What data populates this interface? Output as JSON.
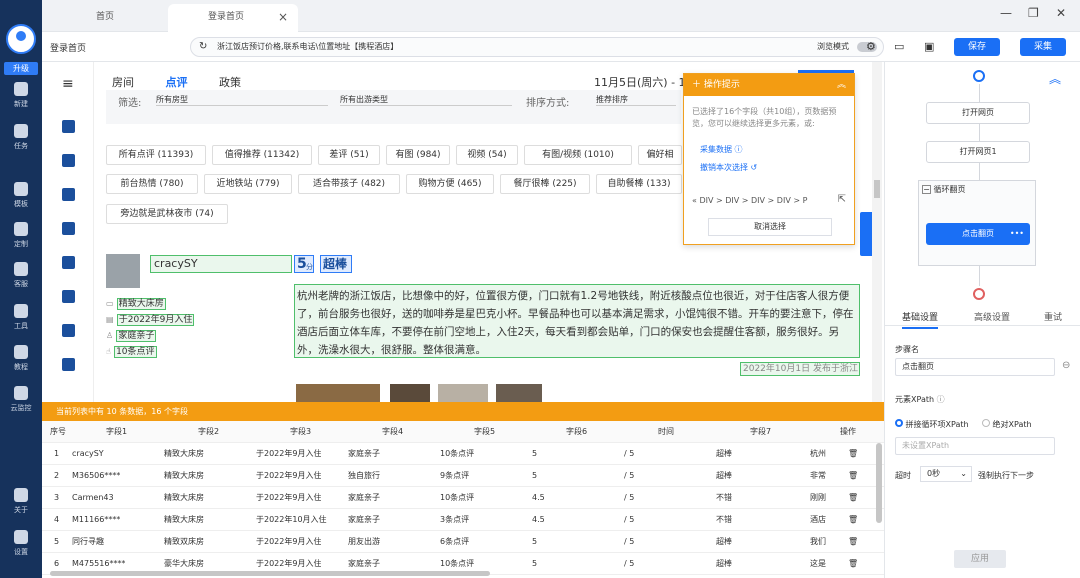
{
  "app": {
    "upgrade": "升级"
  },
  "nav": [
    {
      "label": "新建"
    },
    {
      "label": "任务"
    },
    {
      "label": "模板"
    },
    {
      "label": "定制"
    },
    {
      "label": "客服"
    },
    {
      "label": "工具"
    },
    {
      "label": "教程"
    },
    {
      "label": "云监控"
    },
    {
      "label": "关于"
    },
    {
      "label": "设置"
    }
  ],
  "tabs": {
    "home": "首页",
    "active": "登录首页"
  },
  "toolbar": {
    "left_label": "登录首页",
    "url": "浙江饭店预订价格,联系电话\\位置地址【携程酒店】",
    "browse_mode": "浏览模式",
    "save": "保存",
    "collect": "采集"
  },
  "page": {
    "tabs": [
      "房间",
      "点评",
      "政策"
    ],
    "date": "11月5日(周六) - 11",
    "filter_label": "筛选:",
    "room_select": "所有房型",
    "trip_select": "所有出游类型",
    "sort_label": "排序方式:",
    "sort_select": "推荐排序",
    "chips_row1": [
      "所有点评 (11393)",
      "值得推荐 (11342)",
      "差评 (51)",
      "有图 (984)",
      "视频 (54)",
      "有图/视频 (1010)",
      "偏好相"
    ],
    "chips_row2": [
      "前台热情 (780)",
      "近地铁站 (779)",
      "适合带孩子 (482)",
      "购物方便 (465)",
      "餐厅很棒 (225)",
      "自助餐棒 (133)"
    ],
    "chips_row3": [
      "旁边就是武林夜市 (74)"
    ],
    "review": {
      "user": "cracySY",
      "score": "5",
      "score_unit": "分",
      "rating_word": "超棒",
      "room": "精致大床房",
      "stay": "于2022年9月入住",
      "trip": "家庭亲子",
      "count": "10条点评",
      "text": "杭州老牌的浙江饭店，比想像中的好，位置很方便，门口就有1.2号地铁线，附近核酸点位也很近，对于住店客人很方便了，前台服务也很好，送的咖啡券是星巴克小杯。早餐品种也可以基本满足需求，小馄饨很不错。开车的要注意下，停在酒店后面立体车库，不要停在前门空地上，入住2天，每天看到都会贴单，门口的保安也会提醒住客额，服务很好。另外，洗澡水很大，很舒服。整体很满意。",
      "date": "2022年10月1日 发布于浙江"
    }
  },
  "tip": {
    "title": "操作提示",
    "desc": "已选择了16个字段（共10组），页数据预览，您可以继续选择更多元素，或:",
    "collect": "采集数据",
    "undo": "撤销本次选择",
    "path": "DIV > DIV > DIV > DIV > P",
    "cancel": "取消选择"
  },
  "data": {
    "summary": "当前列表中有 10 条数据，16 个字段",
    "headers": [
      "序号",
      "字段1",
      "字段2",
      "字段3",
      "字段4",
      "字段5",
      "字段6",
      "时间",
      "字段7",
      "",
      "操作"
    ],
    "rows": [
      [
        "1",
        "cracySY",
        "精致大床房",
        "于2022年9月入住",
        "家庭亲子",
        "10条点评",
        "5",
        "/ 5",
        "超棒",
        "杭州"
      ],
      [
        "2",
        "M36506****",
        "精致大床房",
        "于2022年9月入住",
        "独自旅行",
        "9条点评",
        "5",
        "/ 5",
        "超棒",
        "非常"
      ],
      [
        "3",
        "Carmen43",
        "精致大床房",
        "于2022年9月入住",
        "家庭亲子",
        "10条点评",
        "4.5",
        "/ 5",
        "不错",
        "刚刚"
      ],
      [
        "4",
        "M11166****",
        "精致大床房",
        "于2022年10月入住",
        "家庭亲子",
        "3条点评",
        "4.5",
        "/ 5",
        "不错",
        "酒店"
      ],
      [
        "5",
        "同行寻趣",
        "精致双床房",
        "于2022年9月入住",
        "朋友出游",
        "6条点评",
        "5",
        "/ 5",
        "超棒",
        "我们"
      ],
      [
        "6",
        "M475516****",
        "豪华大床房",
        "于2022年9月入住",
        "家庭亲子",
        "10条点评",
        "5",
        "/ 5",
        "超棒",
        "这是"
      ]
    ]
  },
  "right": {
    "flow": [
      "打开网页",
      "打开网页1",
      "循环翻页",
      "点击翻页"
    ],
    "tabs": [
      "基础设置",
      "高级设置",
      "重试"
    ],
    "step_name_label": "步骤名",
    "step_name": "点击翻页",
    "xpath_label": "元素XPath",
    "xpath_opt1": "拼接循环项XPath",
    "xpath_opt2": "绝对XPath",
    "xpath_placeholder": "未设置XPath",
    "timeout_label": "超时",
    "timeout_value": "0秒",
    "force_next": "强制执行下一步",
    "apply": "应用"
  },
  "colors": {
    "accent": "#1a6ff5",
    "warning": "#f39c12",
    "nav": "#16325c",
    "select_green": "#4fbf6b"
  }
}
